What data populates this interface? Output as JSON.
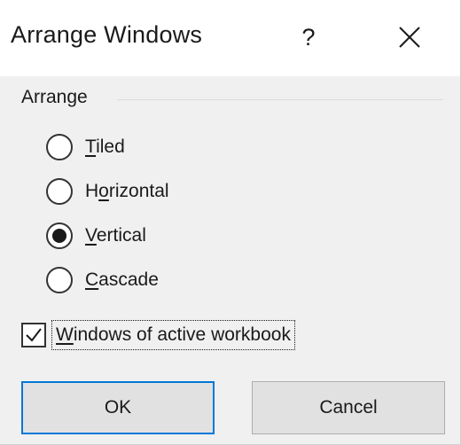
{
  "dialog": {
    "title": "Arrange Windows",
    "help_label": "?",
    "close_icon": "close-icon"
  },
  "arrange": {
    "group_label": "Arrange",
    "options": [
      {
        "label": "Tiled",
        "mnemonic_index": 0,
        "checked": false
      },
      {
        "label": "Horizontal",
        "mnemonic_index": 1,
        "checked": false
      },
      {
        "label": "Vertical",
        "mnemonic_index": 0,
        "checked": true
      },
      {
        "label": "Cascade",
        "mnemonic_index": 0,
        "checked": false
      }
    ]
  },
  "active_workbook": {
    "label": "Windows of active workbook",
    "mnemonic_index": 0,
    "checked": true
  },
  "buttons": {
    "ok_label": "OK",
    "cancel_label": "Cancel"
  },
  "colors": {
    "accent": "#0078d7",
    "background": "#f0f0f0",
    "titlebar": "#ffffff"
  }
}
